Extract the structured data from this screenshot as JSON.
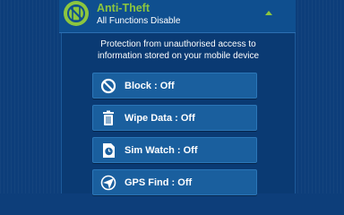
{
  "header": {
    "title": "Anti-Theft",
    "subtitle": "All Functions Disable",
    "icon": "no-phone-icon"
  },
  "panel": {
    "description_line1": "Protection from unauthorised access to",
    "description_line2": "information stored on your mobile device"
  },
  "buttons": [
    {
      "label": "Block : Off",
      "icon": "block-icon"
    },
    {
      "label": "Wipe Data : Off",
      "icon": "trash-icon"
    },
    {
      "label": "Sim Watch : Off",
      "icon": "sim-watch-icon"
    },
    {
      "label": "GPS Find : Off",
      "icon": "gps-icon"
    }
  ],
  "colors": {
    "accent": "#8cc63f",
    "background": "#0d3e7a",
    "button": "#1a5f9e"
  }
}
